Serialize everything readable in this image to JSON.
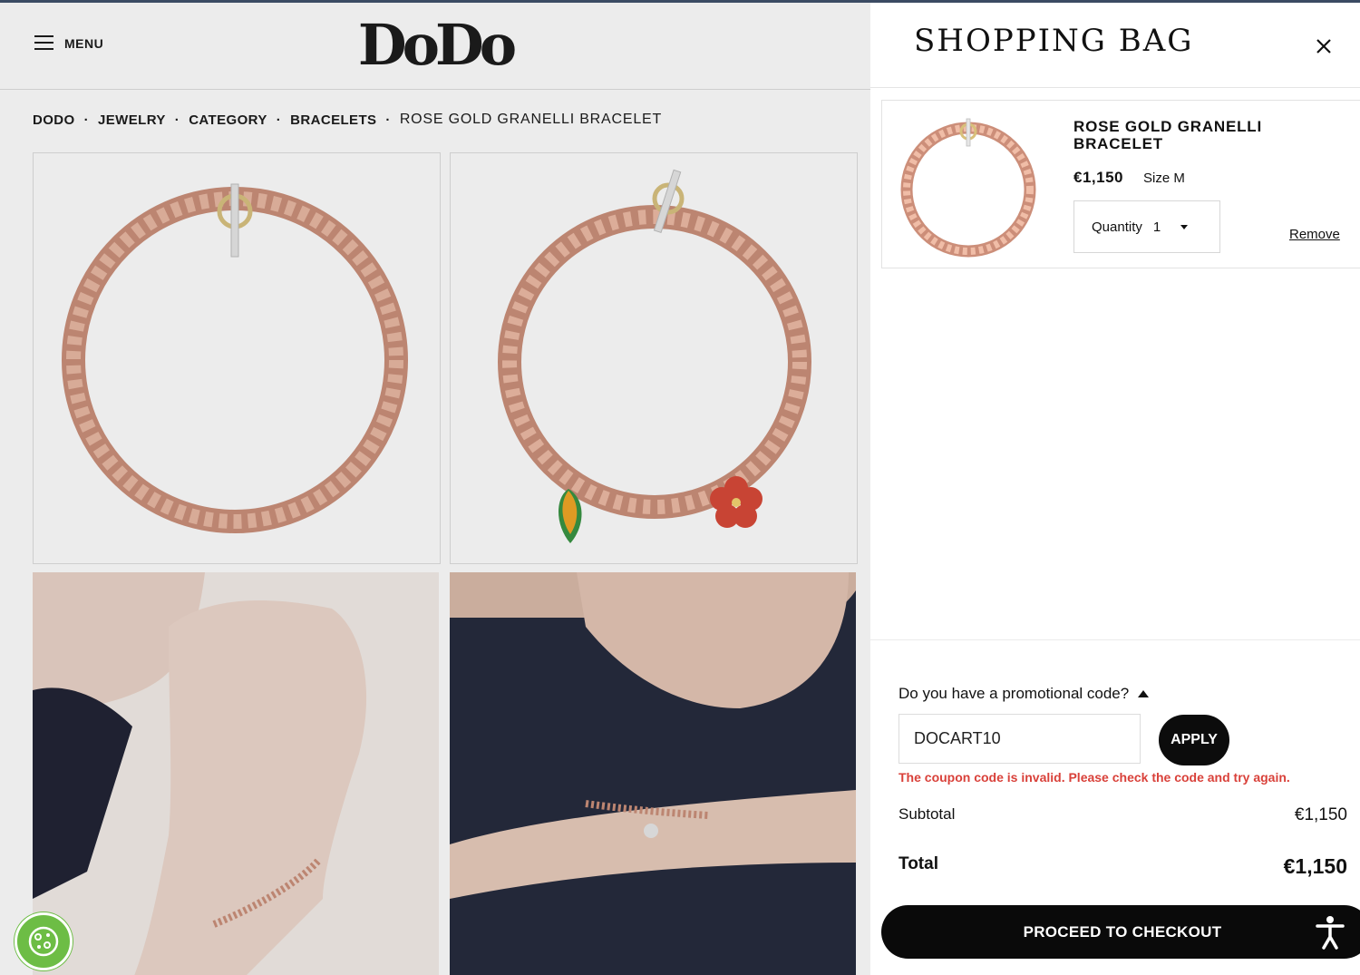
{
  "header": {
    "menu_label": "MENU",
    "logo": "DoDo"
  },
  "breadcrumb": {
    "items": [
      "DODO",
      "JEWELRY",
      "CATEGORY",
      "BRACELETS"
    ],
    "current": "ROSE GOLD GRANELLI BRACELET",
    "separator": "·"
  },
  "bag": {
    "title": "SHOPPING BAG",
    "item": {
      "name": "ROSE GOLD GRANELLI BRACELET",
      "price": "€1,150",
      "size": "Size M",
      "quantity_label": "Quantity",
      "quantity_value": "1",
      "remove_label": "Remove"
    },
    "promo": {
      "question": "Do you have a promotional code?",
      "code_value": "DOCART10",
      "apply_label": "APPLY",
      "error": "The coupon code is invalid. Please check the code and try again."
    },
    "subtotal_label": "Subtotal",
    "subtotal_value": "€1,150",
    "total_label": "Total",
    "total_value": "€1,150",
    "checkout_label": "PROCEED TO CHECKOUT"
  },
  "colors": {
    "accent": "#0a0a0a",
    "error": "#d9413a",
    "cookie_badge": "#6dbd45",
    "rose_gold": "#d99a82"
  },
  "icons": [
    "menu-icon",
    "close-icon",
    "cookie-icon",
    "accessibility-icon",
    "caret-down-icon",
    "caret-up-icon"
  ]
}
